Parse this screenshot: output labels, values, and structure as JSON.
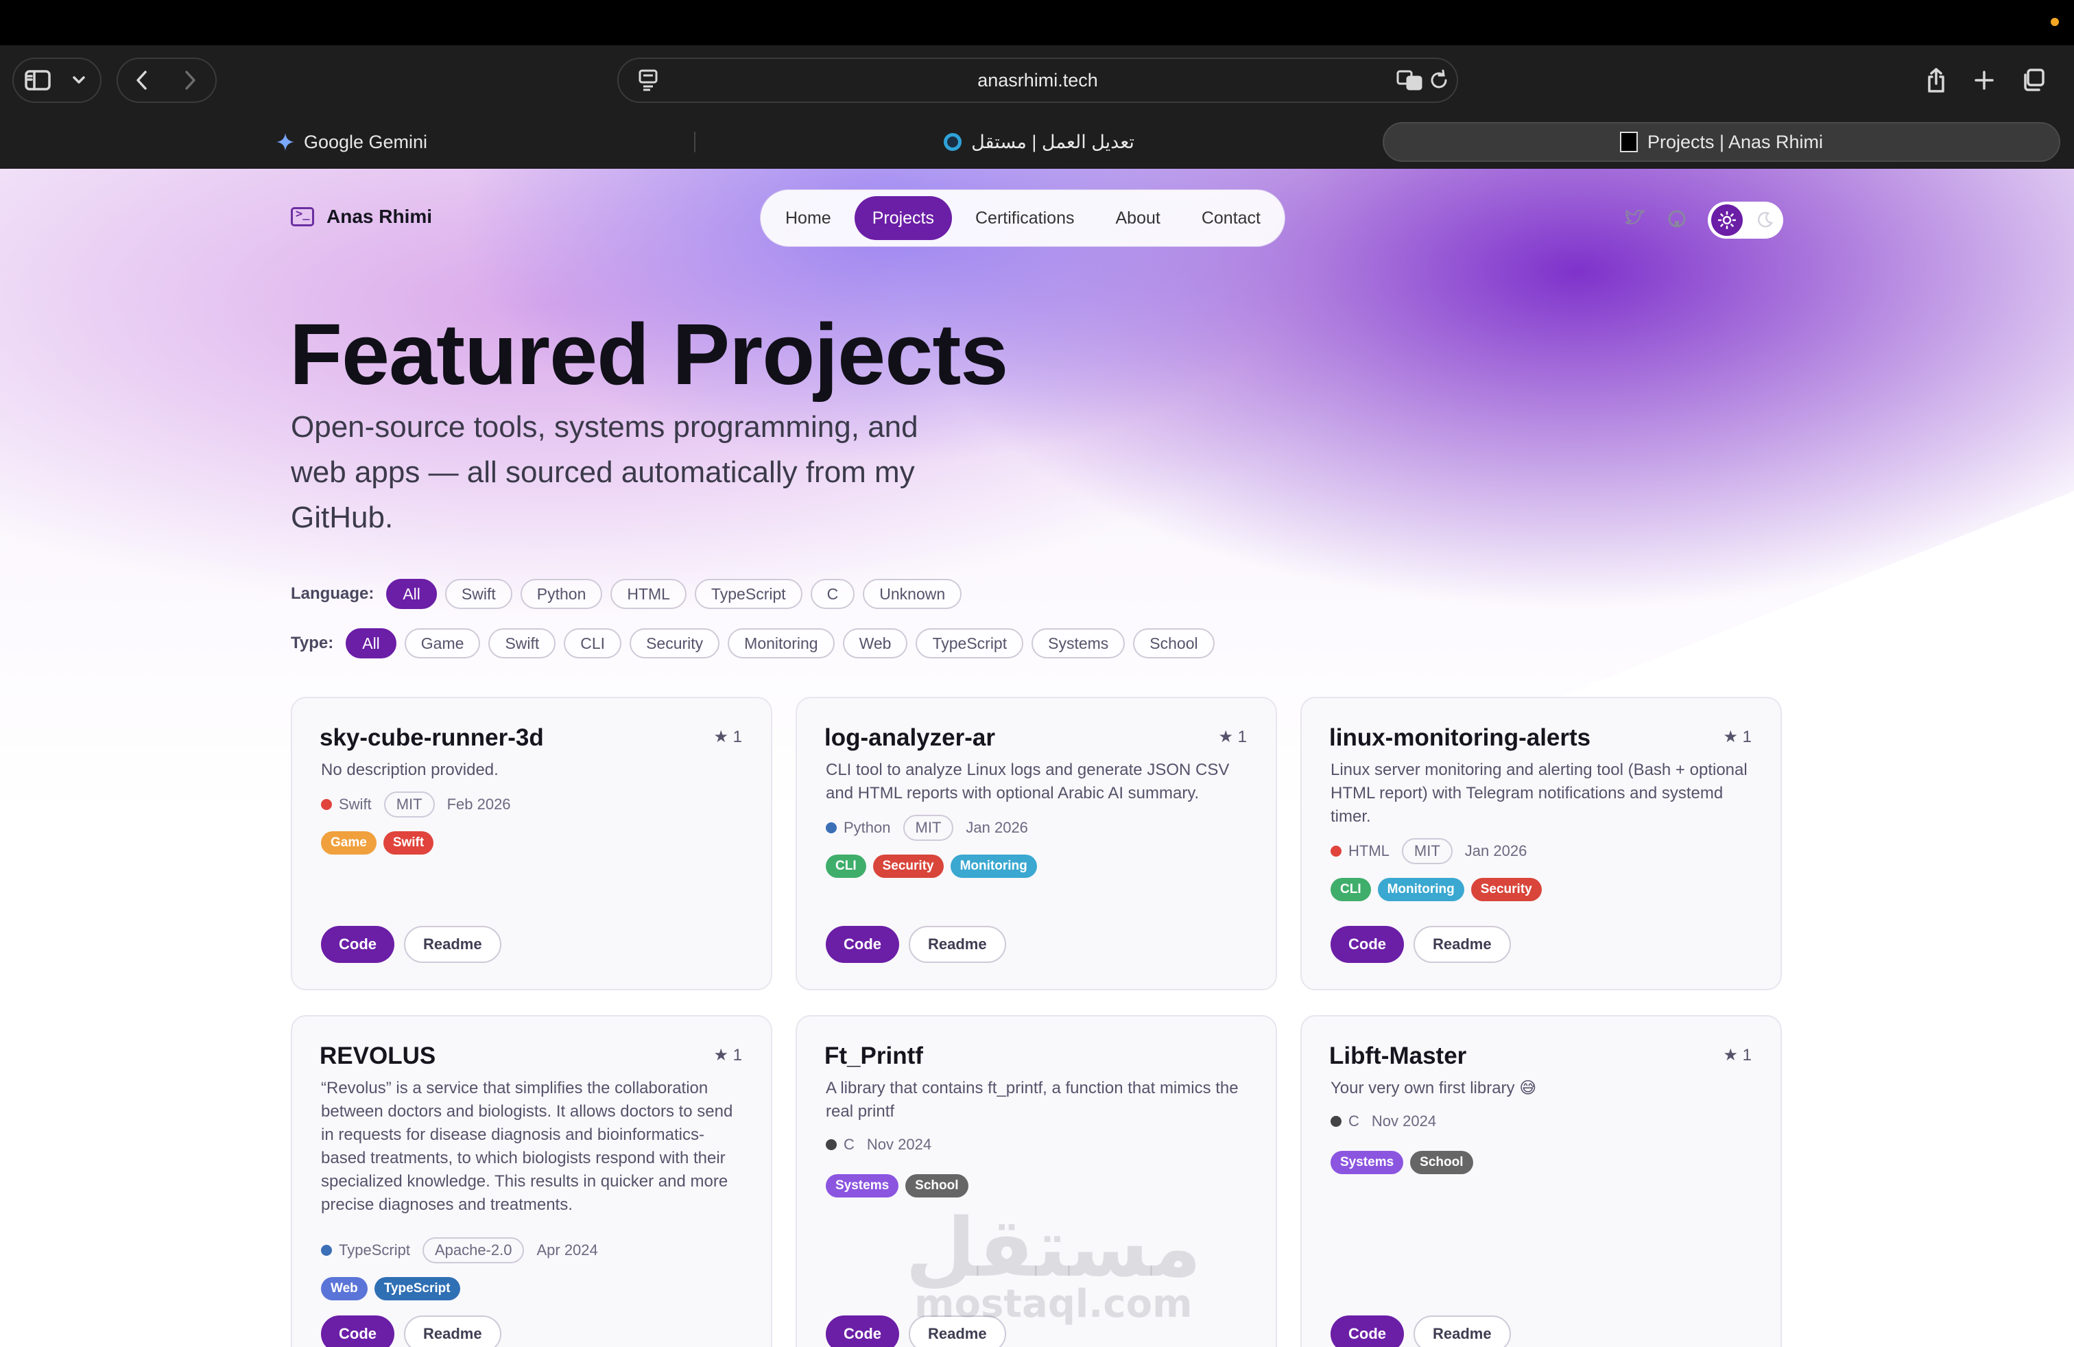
{
  "browser": {
    "url": "anasrhimi.tech",
    "tabs": [
      {
        "label": "Google Gemini",
        "icon": "gemini-sparkle-icon"
      },
      {
        "label": "تعديل العمل | مستقل",
        "icon": "mostaql-icon"
      },
      {
        "label": "Projects | Anas Rhimi",
        "icon": "site-favicon"
      }
    ]
  },
  "site": {
    "brand": "Anas Rhimi",
    "nav": [
      "Home",
      "Projects",
      "Certifications",
      "About",
      "Contact"
    ],
    "active_nav": "Projects",
    "accent": "#6b1ea6"
  },
  "hero": {
    "title": "Featured Projects",
    "subtitle": "Open-source tools, systems programming, and web apps — all sourced automatically from my GitHub."
  },
  "filters": {
    "language_label": "Language:",
    "language": [
      "All",
      "Swift",
      "Python",
      "HTML",
      "TypeScript",
      "C",
      "Unknown"
    ],
    "type_label": "Type:",
    "type": [
      "All",
      "Game",
      "Swift",
      "CLI",
      "Security",
      "Monitoring",
      "Web",
      "TypeScript",
      "Systems",
      "School"
    ]
  },
  "cards": [
    {
      "title": "sky-cube-runner-3d",
      "stars": "★ 1",
      "desc": "No description provided.",
      "lang": "Swift",
      "lang_color": "#e0443c",
      "license": "MIT",
      "date": "Feb 2026",
      "tags": [
        {
          "label": "Game",
          "color": "#f0a03c"
        },
        {
          "label": "Swift",
          "color": "#e0443c"
        }
      ],
      "code": "Code",
      "readme": "Readme"
    },
    {
      "title": "log-analyzer-ar",
      "stars": "★ 1",
      "desc": "CLI tool to analyze Linux logs and generate JSON CSV and HTML reports with optional Arabic AI summary.",
      "lang": "Python",
      "lang_color": "#3b6fb6",
      "license": "MIT",
      "date": "Jan 2026",
      "tags": [
        {
          "label": "CLI",
          "color": "#3fae6b"
        },
        {
          "label": "Security",
          "color": "#d9453a"
        },
        {
          "label": "Monitoring",
          "color": "#3aa8d0"
        }
      ],
      "code": "Code",
      "readme": "Readme"
    },
    {
      "title": "linux-monitoring-alerts",
      "stars": "★ 1",
      "desc": "Linux server monitoring and alerting tool (Bash + optional HTML report) with Telegram notifications and systemd timer.",
      "lang": "HTML",
      "lang_color": "#e0443c",
      "license": "MIT",
      "date": "Jan 2026",
      "tags": [
        {
          "label": "CLI",
          "color": "#3fae6b"
        },
        {
          "label": "Monitoring",
          "color": "#3aa8d0"
        },
        {
          "label": "Security",
          "color": "#d9453a"
        }
      ],
      "code": "Code",
      "readme": "Readme"
    },
    {
      "title": "REVOLUS",
      "stars": "★ 1",
      "desc": "“Revolus” is a service that simplifies the collaboration between doctors and biologists. It allows doctors to send in requests for disease diagnosis and bioinformatics-based treatments, to which biologists respond with their specialized knowledge. This results in quicker and more precise diagnoses and treatments.",
      "lang": "TypeScript",
      "lang_color": "#3b6fb6",
      "license": "Apache-2.0",
      "date": "Apr 2024",
      "tags": [
        {
          "label": "Web",
          "color": "#5a74d8"
        },
        {
          "label": "TypeScript",
          "color": "#2f6fb4"
        }
      ],
      "code": "Code",
      "readme": "Readme"
    },
    {
      "title": "Ft_Printf",
      "stars": "",
      "desc": "A library that contains ft_printf, a function that mimics the real printf",
      "lang": "C",
      "lang_color": "#444444",
      "license": "",
      "date": "Nov 2024",
      "tags": [
        {
          "label": "Systems",
          "color": "#8b55e0"
        },
        {
          "label": "School",
          "color": "#666666"
        }
      ],
      "code": "Code",
      "readme": "Readme"
    },
    {
      "title": "Libft-Master",
      "stars": "★ 1",
      "desc": "Your very own first library 😅",
      "lang": "C",
      "lang_color": "#444444",
      "license": "",
      "date": "Nov 2024",
      "tags": [
        {
          "label": "Systems",
          "color": "#8b55e0"
        },
        {
          "label": "School",
          "color": "#666666"
        }
      ],
      "code": "Code",
      "readme": "Readme"
    }
  ],
  "watermark": {
    "arabic": "مستقل",
    "latin": "mostaql.com"
  }
}
